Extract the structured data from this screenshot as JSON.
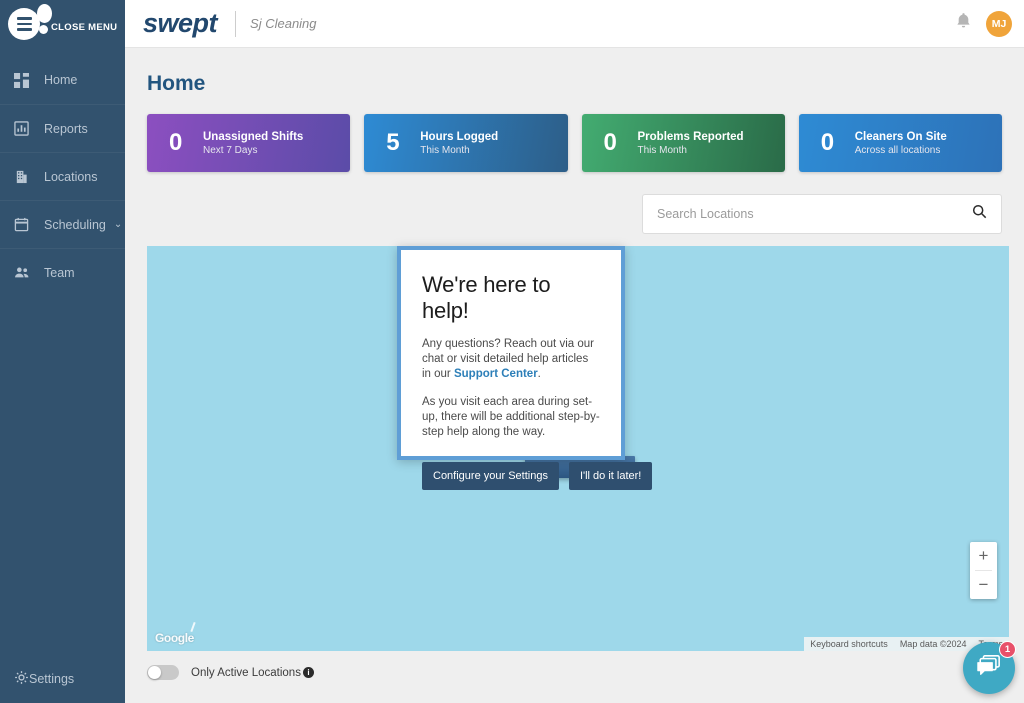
{
  "sidebar": {
    "close_menu_label": "CLOSE MENU",
    "items": [
      {
        "label": "Home",
        "icon": "grid-icon"
      },
      {
        "label": "Reports",
        "icon": "bar-chart-icon"
      },
      {
        "label": "Locations",
        "icon": "building-icon"
      },
      {
        "label": "Scheduling",
        "icon": "calendar-icon",
        "chevron": "⌄"
      },
      {
        "label": "Team",
        "icon": "people-icon"
      }
    ],
    "settings_label": "Settings"
  },
  "header": {
    "logo_text": "swept",
    "client_name": "Sj Cleaning",
    "avatar_initials": "MJ",
    "notification_icon": "bell-icon"
  },
  "main": {
    "page_title": "Home",
    "cards": [
      {
        "value": "0",
        "title": "Unassigned Shifts",
        "subtitle": "Next 7 Days",
        "color": "#8c4fc0"
      },
      {
        "value": "5",
        "title": "Hours Logged",
        "subtitle": "This Month",
        "color": "#2e8bd4"
      },
      {
        "value": "0",
        "title": "Problems Reported",
        "subtitle": "This Month",
        "color": "#43ac71"
      },
      {
        "value": "0",
        "title": "Cleaners On Site",
        "subtitle": "Across all locations",
        "color": "#2e8bd4"
      }
    ],
    "search": {
      "placeholder": "Search Locations",
      "value": "",
      "icon": "search-icon"
    },
    "map": {
      "logo": "Google",
      "keyboard_shortcuts": "Keyboard shortcuts",
      "map_data": "Map data ©2024",
      "terms": "Terms",
      "zoom_in": "+",
      "zoom_out": "−"
    },
    "toggle": {
      "label": "Only Active Locations",
      "state": "off",
      "info_icon": "info-icon",
      "info_char": "i"
    }
  },
  "modal": {
    "title": "We're here to help!",
    "paragraph1_a": "Any questions? Reach out via our chat or visit detailed help articles in our ",
    "link_text": "Support Center",
    "paragraph1_b": ".",
    "paragraph2": "As you visit each area during set-up, there will be additional step-by-step help along the way.",
    "primary_button": "Configure your Settings",
    "secondary_button": "I'll do it later!"
  },
  "chat": {
    "badge_count": "1",
    "icon": "chat-bubble-icon"
  }
}
